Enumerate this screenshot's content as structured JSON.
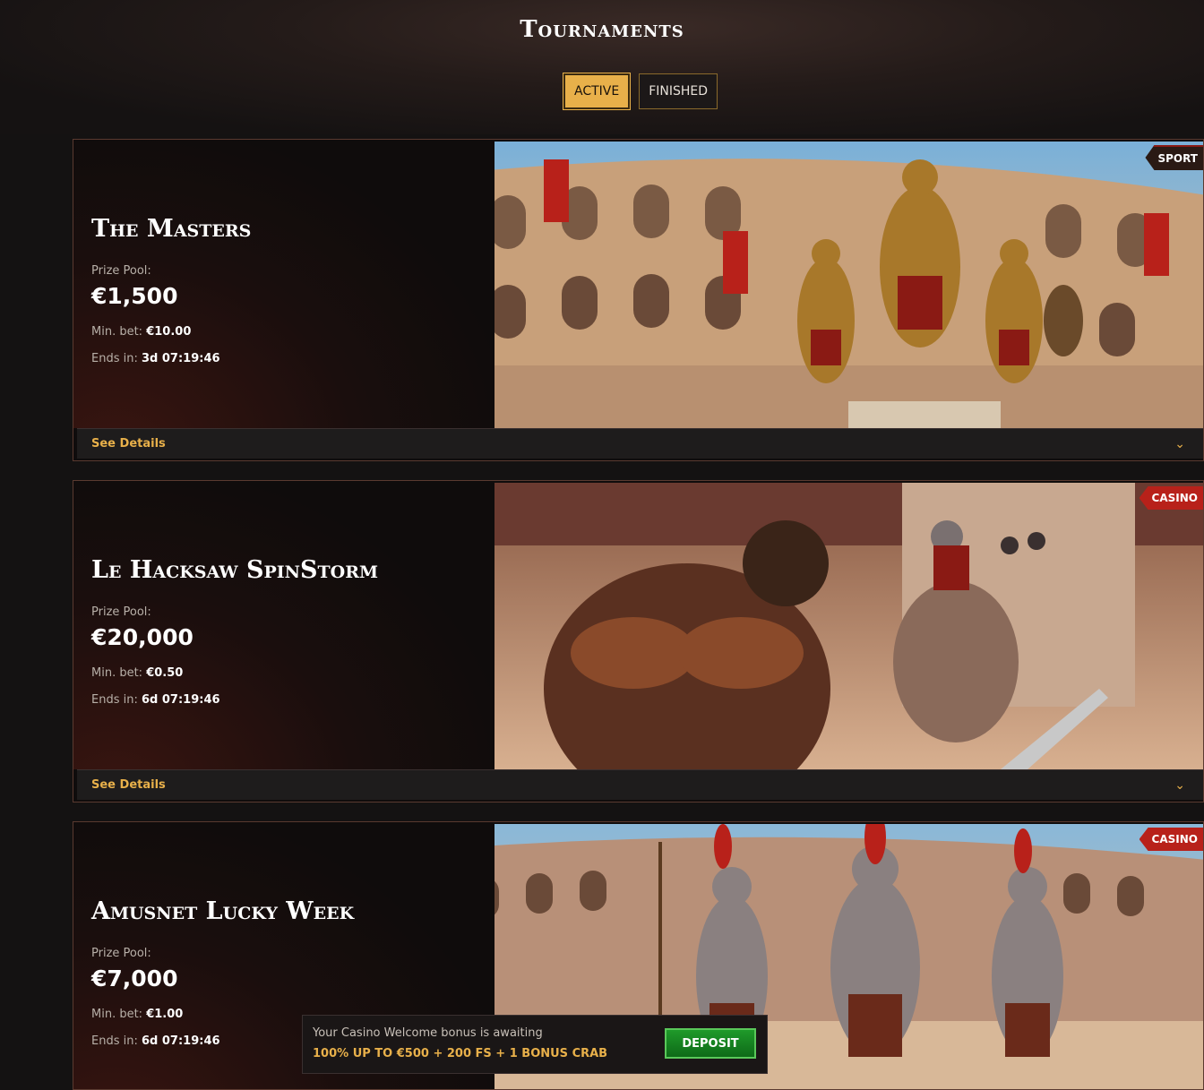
{
  "page": {
    "title": "Tournaments"
  },
  "tabs": [
    {
      "label": "ACTIVE",
      "active": true
    },
    {
      "label": "FINISHED",
      "active": false
    }
  ],
  "labels": {
    "prize_pool": "Prize Pool:",
    "min_bet": "Min. bet:",
    "ends_in": "Ends in:",
    "see_details": "See Details"
  },
  "tournaments": [
    {
      "name": "The Masters",
      "prize": "€1,500",
      "min_bet": "€10.00",
      "ends_in": "3d 07:19:46",
      "badge": "SPORT"
    },
    {
      "name": "Le Hacksaw SpinStorm",
      "prize": "€20,000",
      "min_bet": "€0.50",
      "ends_in": "6d 07:19:46",
      "badge": "CASINO"
    },
    {
      "name": "Amusnet Lucky Week",
      "prize": "€7,000",
      "min_bet": "€1.00",
      "ends_in": "6d 07:19:46",
      "badge": "CASINO"
    }
  ],
  "toast": {
    "line1": "Your Casino Welcome bonus is awaiting",
    "line2": "100% UP TO €500 + 200 FS + 1 BONUS CRAB",
    "button": "DEPOSIT"
  },
  "colors": {
    "accent": "#e8b04a",
    "casino_badge": "#b8211a",
    "deposit": "#1f9a2a"
  }
}
